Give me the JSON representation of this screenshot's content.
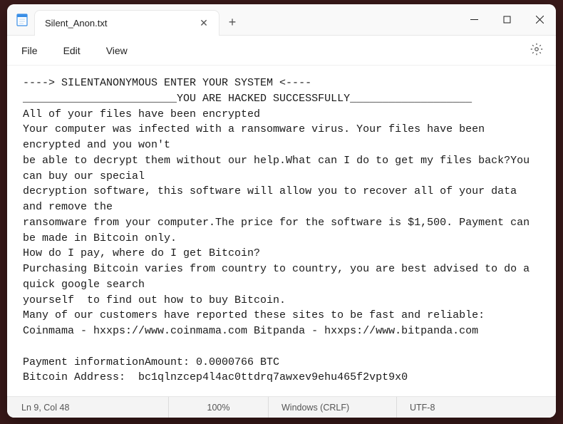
{
  "titlebar": {
    "tab_title": "Silent_Anon.txt",
    "close_tab": "✕",
    "new_tab": "+"
  },
  "menu": {
    "file": "File",
    "edit": "Edit",
    "view": "View"
  },
  "content": {
    "text": "----> SILENTANONYMOUS ENTER YOUR SYSTEM <----\n________________________YOU ARE HACKED SUCCESSFULLY___________________\nAll of your files have been encrypted\nYour computer was infected with a ransomware virus. Your files have been encrypted and you won't\nbe able to decrypt them without our help.What can I do to get my files back?You can buy our special\ndecryption software, this software will allow you to recover all of your data and remove the\nransomware from your computer.The price for the software is $1,500. Payment can be made in Bitcoin only.\nHow do I pay, where do I get Bitcoin?\nPurchasing Bitcoin varies from country to country, you are best advised to do a quick google search\nyourself  to find out how to buy Bitcoin.\nMany of our customers have reported these sites to be fast and reliable:\nCoinmama - hxxps://www.coinmama.com Bitpanda - hxxps://www.bitpanda.com\n\nPayment informationAmount: 0.0000766 BTC\nBitcoin Address:  bc1qlnzcep4l4ac0ttdrq7awxev9ehu465f2vpt9x0"
  },
  "status": {
    "position": "Ln 9, Col 48",
    "zoom": "100%",
    "line_ending": "Windows (CRLF)",
    "encoding": "UTF-8"
  }
}
